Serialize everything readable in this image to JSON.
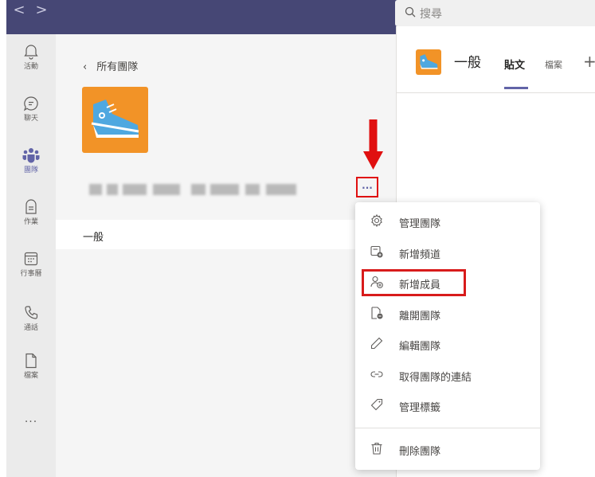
{
  "titlebar": {
    "back_glyph": "<",
    "forward_glyph": ">",
    "search_placeholder": "搜尋"
  },
  "rail": {
    "items": [
      {
        "label": "活動",
        "icon": "bell-icon"
      },
      {
        "label": "聊天",
        "icon": "chat-icon"
      },
      {
        "label": "團隊",
        "icon": "teams-icon",
        "active": true
      },
      {
        "label": "作業",
        "icon": "assignments-icon"
      },
      {
        "label": "行事曆",
        "icon": "calendar-icon"
      },
      {
        "label": "通話",
        "icon": "phone-icon"
      },
      {
        "label": "檔案",
        "icon": "file-icon"
      }
    ],
    "more_label": "..."
  },
  "team_panel": {
    "back_label": "所有團隊",
    "more_label": "...",
    "channel_label": "一般"
  },
  "channel_header": {
    "title": "一般",
    "tabs": [
      {
        "label": "貼文",
        "active": true
      },
      {
        "label": "檔案"
      }
    ],
    "add_tab_label": "+"
  },
  "context_menu": {
    "items": [
      {
        "label": "管理團隊",
        "icon": "gear-icon"
      },
      {
        "label": "新增頻道",
        "icon": "add-channel-icon"
      },
      {
        "label": "新增成員",
        "icon": "add-member-icon",
        "highlighted": true
      },
      {
        "label": "離開團隊",
        "icon": "leave-team-icon"
      },
      {
        "label": "編輯團隊",
        "icon": "pencil-icon"
      },
      {
        "label": "取得團隊的連結",
        "icon": "link-icon"
      },
      {
        "label": "管理標籤",
        "icon": "tag-icon"
      },
      {
        "label": "刪除團隊",
        "icon": "trash-icon"
      }
    ]
  },
  "colors": {
    "titlebar": "#464775",
    "rail": "#ebebeb",
    "panel": "#f5f5f5",
    "accent": "#6264a7",
    "team_avatar": "#f29327",
    "annotation_red": "#e01010"
  }
}
